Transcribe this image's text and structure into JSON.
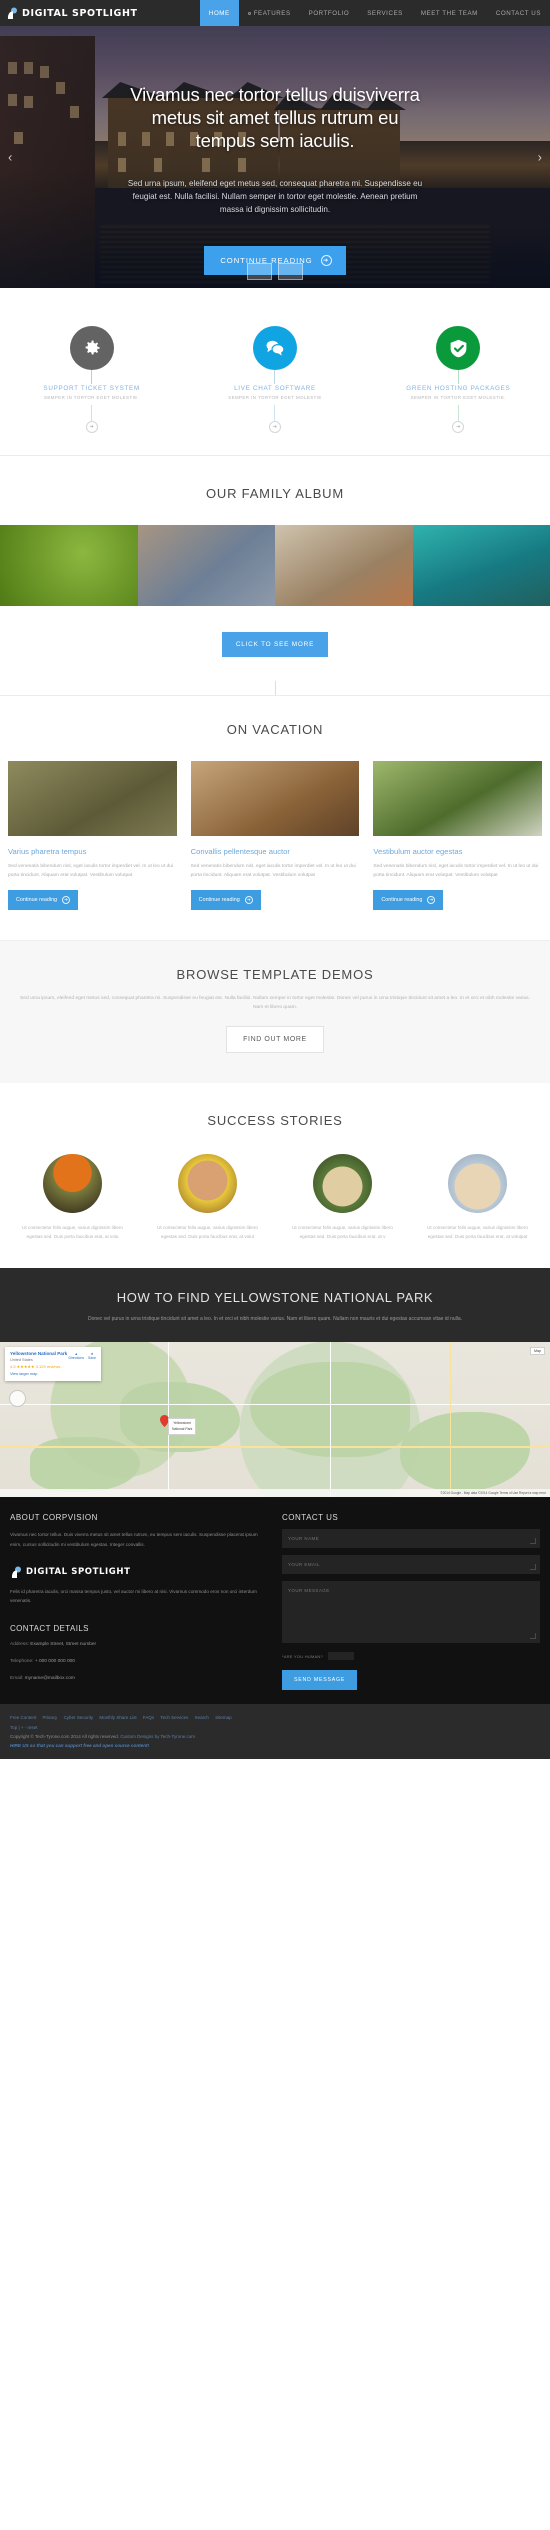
{
  "brand": {
    "name": "DIGITAL SPOTLIGHT",
    "logo_icon": "head-bulb-icon"
  },
  "nav": {
    "items": [
      {
        "label": "HOME",
        "active": true,
        "dot": false
      },
      {
        "label": "FEATURES",
        "active": false,
        "dot": true
      },
      {
        "label": "PORTFOLIO",
        "active": false,
        "dot": false
      },
      {
        "label": "SERVICES",
        "active": false,
        "dot": false
      },
      {
        "label": "MEET THE TEAM",
        "active": false,
        "dot": false
      },
      {
        "label": "CONTACT US",
        "active": false,
        "dot": false
      }
    ]
  },
  "hero": {
    "title": "Vivamus nec tortor tellus duisviverra metus sit amet tellus rutrum eu tempus sem iaculis.",
    "subtitle": "Sed urna ipsum, eleifend eget metus sed, consequat pharetra mi. Suspendisse eu feugiat est. Nulla facilisi. Nullam semper in tortor eget molestie. Aenean pretium massa id dignissim sollicitudin.",
    "cta_label": "CONTINUE READING",
    "cta_icon": "arrow-right-circle-icon",
    "prev_icon": "chevron-left-icon",
    "next_icon": "chevron-right-icon",
    "thumbnails": [
      "slide-thumb-1",
      "slide-thumb-2"
    ]
  },
  "services": [
    {
      "title": "SUPPORT TICKET SYSTEM",
      "subtitle": "SEMPER IN TORTOR EGET MOLESTIE.",
      "icon": "gear-icon",
      "color": "#636363",
      "title_color": "#7fb4e2",
      "line_color": "#c9c9c9",
      "plus_icon": "arrow-right-small-icon"
    },
    {
      "title": "LIVE CHAT SOFTWARE",
      "subtitle": "SEMPER IN TORTOR EGET MOLESTIE",
      "icon": "chat-bubbles-icon",
      "color": "#11a4e2",
      "title_color": "#7fb4e2",
      "line_color": "#bcd9ec",
      "plus_icon": "arrow-right-small-icon"
    },
    {
      "title": "GREEN HOSTING PACKAGES",
      "subtitle": "SEMPER IN TORTOR EGET MOLESTIE.",
      "icon": "shield-check-icon",
      "color": "#0a9a3c",
      "title_color": "#7fb4e2",
      "line_color": "#b5dcc2",
      "plus_icon": "arrow-right-small-icon"
    }
  ],
  "album": {
    "heading": "OUR FAMILY ALBUM",
    "cells": [
      "bird-yellow-breast",
      "little-penguins",
      "mandarin-duck",
      "spadefish"
    ],
    "cta_label": "CLICK TO SEE MORE"
  },
  "vacation": {
    "heading": "ON VACATION",
    "cards": [
      {
        "image": "frog-photo",
        "title": "Varius pharetra tempus",
        "text": "Sed venenatis bibendum nisl, eget iaculis tortor imperdiet vel. In ut leo ut dui porta tincidunt. Aliquam erat volutpat. Vestibulum volutpat",
        "cta_label": "Continue reading",
        "cta_icon": "arrow-right-circle-icon"
      },
      {
        "image": "sea-lion-photo",
        "title": "Convallis pellentesque auctor",
        "text": "Sed venenatis bibendum nisl, eget iaculis tortor imperdiet vel. In ut leo ut dui porta tincidunt. Aliquam erat volutpat. Vestibulum volutpat",
        "cta_label": "Continue reading",
        "cta_icon": "arrow-right-circle-icon"
      },
      {
        "image": "pelican-photo",
        "title": "Vestibulum auctor egestas",
        "text": "Sed venenatis bibendum nisl, eget iaculis tortor imperdiet vel. In ut leo ut dui porta tincidunt. Aliquam erat volutpat. Vestibulum volutpat",
        "cta_label": "Continue reading",
        "cta_icon": "arrow-right-circle-icon"
      }
    ]
  },
  "demos": {
    "heading": "BROWSE TEMPLATE DEMOS",
    "text": "Sed urna ipsum, eleifend eget metus sed, consequat pharetra mi. Suspendisse eu feugiat est. Nulla facilisi. Nullam semper in tortor eget molestie. Donec vel purus in urna tristique tincidunt sit amet a leo. In et orci et nibh molestie varius. Nam et libero quam.",
    "cta_label": "FIND OUT MORE"
  },
  "success": {
    "heading": "SUCCESS STORIES",
    "cards": [
      {
        "avatar": "red-ruffed-lemur",
        "text": "Ut consectetur felis augue, varius dignissim libero egestas sed. Duis porta faucibus erat, at volu"
      },
      {
        "avatar": "red-panda",
        "text": "Ut consectetur felis augue, varius dignissim libero egestas sed. Duis porta faucibus erat, at volut"
      },
      {
        "avatar": "leopard",
        "text": "Ut consectetur felis augue, varius dignissim libero egestas sed. Duis porta faucibus erat, at v"
      },
      {
        "avatar": "arctic-wolf",
        "text": "Ut consectetur felis augue, varius dignissim libero egestas sed. Duis porta faucibus erat, at volutpat"
      }
    ]
  },
  "map_section": {
    "heading": "HOW TO FIND YELLOWSTONE NATIONAL PARK",
    "text": "Donec vel purus in urna tristique tincidunt sit amet a leo. In et orci et nibh molestie varius. Nam et libero quam. Nullam non mauris et dui egestas accumsan vitae id nulla.",
    "panel": {
      "title": "Yellowstone National Park",
      "subtitle": "United States",
      "rating": "4.5 ★★★★★  3,129 reviews",
      "link": "View larger map",
      "directions_label": "Directions",
      "save_label": "Save",
      "directions_icon": "directions-icon",
      "save_icon": "star-icon"
    },
    "marker_label": "Yellowstone\nNational Park",
    "zoom_label": "Map",
    "attribution": "©2014 Google - Map data ©2014 Google   Terms of Use   Report a map error"
  },
  "footer": {
    "about": {
      "heading": "ABOUT CORPVISION",
      "text": "Vivamus nec tortor tellus. Duis viverra metus sit amet tellus rutrum, eu tempus sem iaculis. Suspendisse placerat ipsum enim, cursus sollicitudin mi vestibulum egestas. Integer convallis.",
      "brand_text": "Felis id pharetra iaculis, orci massa tempus justo, vel auctor mi libero at nisi. Vivamus commodo eros non orci interdum venenatis."
    },
    "contact_details": {
      "heading": "CONTACT DETAILS",
      "rows": [
        {
          "label": "Address:",
          "value": "Example Street, Street number"
        },
        {
          "label": "Telephone:",
          "value": "+ 000 000 000 000"
        },
        {
          "label": "Email:",
          "value": "myname@mailbox.com"
        }
      ]
    },
    "contact_form": {
      "heading": "CONTACT US",
      "name_placeholder": "YOUR NAME",
      "email_placeholder": "YOUR EMAIL",
      "message_placeholder": "YOUR MESSAGE",
      "human_label": "*ARE YOU HUMAN?",
      "submit_label": "SEND MESSAGE"
    }
  },
  "bottom": {
    "links": [
      "Free Content",
      "Privacy",
      "Cyber Security",
      "Monthly Share List",
      "FAQs",
      "Tech Services",
      "Search",
      "Sitemap"
    ],
    "toolbar": "Top |  +   -   reset",
    "copyright": "Copyright © Tech-Tyrone.com 2014 All rights reserved.",
    "copyright_link": "Custom Designs by Tech-Tyrone.com",
    "hire": "HIRE US so that you can support free and open source content!"
  }
}
